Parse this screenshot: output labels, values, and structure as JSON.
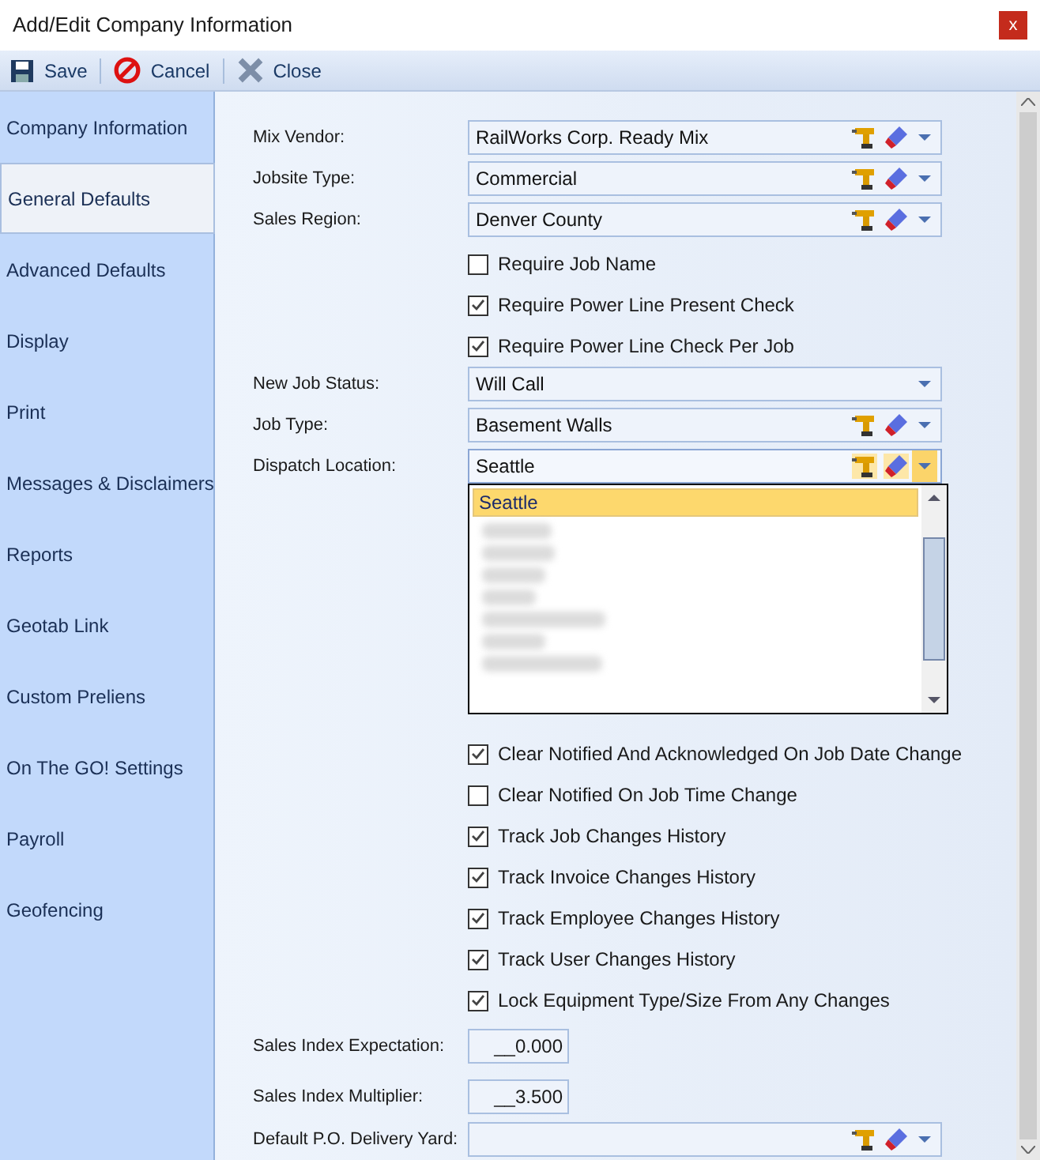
{
  "window": {
    "title": "Add/Edit Company Information",
    "close": "x"
  },
  "toolbar": [
    {
      "kind": "save",
      "label": "Save"
    },
    {
      "kind": "cancel",
      "label": "Cancel"
    },
    {
      "kind": "close",
      "label": "Close"
    }
  ],
  "sidebar": {
    "items": [
      {
        "label": "Company Information",
        "selected": false
      },
      {
        "label": "General Defaults",
        "selected": true
      },
      {
        "label": "Advanced Defaults",
        "selected": false
      },
      {
        "label": "Display",
        "selected": false
      },
      {
        "label": "Print",
        "selected": false
      },
      {
        "label": "Messages & Disclaimers",
        "selected": false
      },
      {
        "label": "Reports",
        "selected": false
      },
      {
        "label": "Geotab Link",
        "selected": false
      },
      {
        "label": "Custom Preliens",
        "selected": false
      },
      {
        "label": "On The GO! Settings",
        "selected": false
      },
      {
        "label": "Payroll",
        "selected": false
      },
      {
        "label": "Geofencing",
        "selected": false
      }
    ]
  },
  "fields": [
    {
      "kind": "combo",
      "label": "Mix Vendor:",
      "value": "RailWorks Corp. Ready Mix",
      "tools": true,
      "open": false
    },
    {
      "kind": "combo",
      "label": "Jobsite Type:",
      "value": "Commercial",
      "tools": true,
      "open": false
    },
    {
      "kind": "combo",
      "label": "Sales Region:",
      "value": "Denver County",
      "tools": true,
      "open": false
    },
    {
      "kind": "checkbox",
      "label": "Require Job Name",
      "checked": false
    },
    {
      "kind": "checkbox",
      "label": "Require Power Line Present Check",
      "checked": true
    },
    {
      "kind": "checkbox",
      "label": "Require Power Line Check Per Job",
      "checked": true
    },
    {
      "kind": "combo",
      "label": "New Job Status:",
      "value": "Will Call",
      "tools": false,
      "open": false
    },
    {
      "kind": "combo",
      "label": "Job Type:",
      "value": "Basement Walls",
      "tools": true,
      "open": false
    },
    {
      "kind": "combo",
      "label": "Dispatch Location:",
      "value": "Seattle",
      "tools": true,
      "open": true,
      "options": [
        {
          "label": "Seattle",
          "selected": true
        }
      ]
    },
    {
      "kind": "checkbox",
      "label": "Clear Notified And Acknowledged On Job Date Change",
      "checked": true
    },
    {
      "kind": "checkbox",
      "label": "Clear Notified On Job Time Change",
      "checked": false
    },
    {
      "kind": "checkbox",
      "label": "Track Job Changes History",
      "checked": true
    },
    {
      "kind": "checkbox",
      "label": "Track Invoice Changes History",
      "checked": true
    },
    {
      "kind": "checkbox",
      "label": "Track Employee Changes History",
      "checked": true
    },
    {
      "kind": "checkbox",
      "label": "Track User Changes History",
      "checked": true
    },
    {
      "kind": "checkbox",
      "label": "Lock Equipment Type/Size From Any Changes",
      "checked": true
    },
    {
      "kind": "number",
      "label": "Sales Index Expectation:",
      "value": "__0.000"
    },
    {
      "kind": "number",
      "label": "Sales Index Multiplier:",
      "value": "__3.500"
    },
    {
      "kind": "combo",
      "label": "Default P.O. Delivery Yard:",
      "tools": true,
      "open": false
    }
  ]
}
